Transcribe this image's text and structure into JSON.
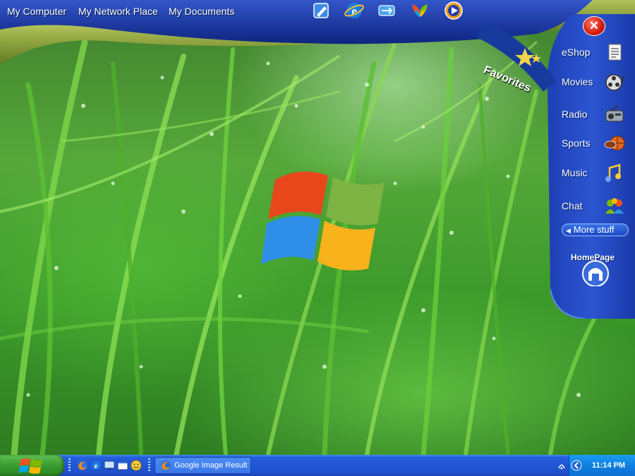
{
  "topbar": {
    "links": [
      "My Computer",
      "My Network Place",
      "My Documents"
    ],
    "quick_icons": [
      "notepad-icon",
      "internet-explorer-icon",
      "network-sync-icon",
      "msn-butterfly-icon",
      "media-player-icon"
    ]
  },
  "sidebar": {
    "close_symbol": "✕",
    "favorites_label": "Favorites",
    "items": [
      {
        "label": "eShop",
        "icon": "shopping-list-icon"
      },
      {
        "label": "Movies",
        "icon": "film-reel-icon"
      },
      {
        "label": "Radio",
        "icon": "radio-icon"
      },
      {
        "label": "Sports",
        "icon": "sports-balls-icon"
      },
      {
        "label": "Music",
        "icon": "music-notes-icon"
      },
      {
        "label": "Chat",
        "icon": "chat-people-icon"
      }
    ],
    "more_stuff_label": "More stuff",
    "homepage_label": "HomePage"
  },
  "taskbar": {
    "task_button_label": "Google Image Result fo...",
    "clock": "11:14 PM",
    "quick_launch": [
      "firefox-icon",
      "internet-explorer-icon",
      "show-desktop-icon",
      "window-icon",
      "smiley-icon"
    ]
  },
  "colors": {
    "topbar_blue": "#1f3fae",
    "olive_swoosh": "#8fa13c",
    "taskbar_blue": "#2156d6",
    "start_green": "#3c9f35",
    "systray_blue": "#0f7fe0"
  }
}
